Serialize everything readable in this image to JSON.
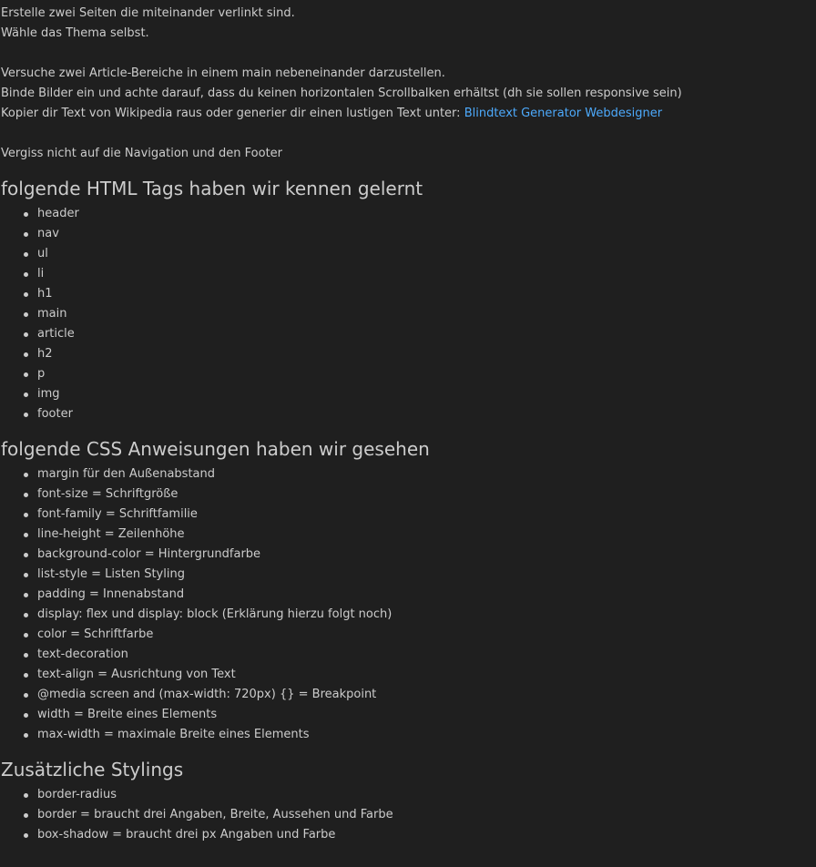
{
  "intro": {
    "line1": "Erstelle zwei Seiten die miteinander verlinkt sind.",
    "line2": "Wähle das Thema selbst.",
    "line3": "Versuche zwei Article-Bereiche in einem main nebeneinander darzustellen.",
    "line4": "Binde Bilder ein und achte darauf, dass du keinen horizontalen Scrollbalken erhältst (dh sie sollen responsive sein)",
    "line5_prefix": "Kopier dir Text von Wikipedia raus oder generier dir einen lustigen Text unter: ",
    "line5_link": "Blindtext Generator Webdesigner",
    "line6": "Vergiss nicht auf die Navigation und den Footer"
  },
  "html_tags": {
    "heading": "folgende HTML Tags haben wir kennen gelernt",
    "items": [
      "header",
      "nav",
      "ul",
      "li",
      "h1",
      "main",
      "article",
      "h2",
      "p",
      "img",
      "footer"
    ]
  },
  "css_rules": {
    "heading": "folgende CSS Anweisungen haben wir gesehen",
    "items": [
      "margin für den Außenabstand",
      "font-size = Schriftgröße",
      "font-family = Schriftfamilie",
      "line-height = Zeilenhöhe",
      "background-color = Hintergrundfarbe",
      "list-style = Listen Styling",
      "padding = Innenabstand",
      "display: flex und display: block (Erklärung hierzu folgt noch)",
      "color = Schriftfarbe",
      "text-decoration",
      "text-align = Ausrichtung von Text",
      "@media screen and (max-width: 720px) {} = Breakpoint",
      "width = Breite eines Elements",
      "max-width = maximale Breite eines Elements"
    ]
  },
  "extra_styles": {
    "heading": "Zusätzliche Stylings",
    "items": [
      "border-radius",
      "border = braucht drei Angaben, Breite, Aussehen und Farbe",
      "box-shadow = braucht drei px Angaben und Farbe"
    ]
  },
  "colors": {
    "background": "#1f1f1f",
    "text": "#cccccc",
    "link": "#4daafc"
  }
}
